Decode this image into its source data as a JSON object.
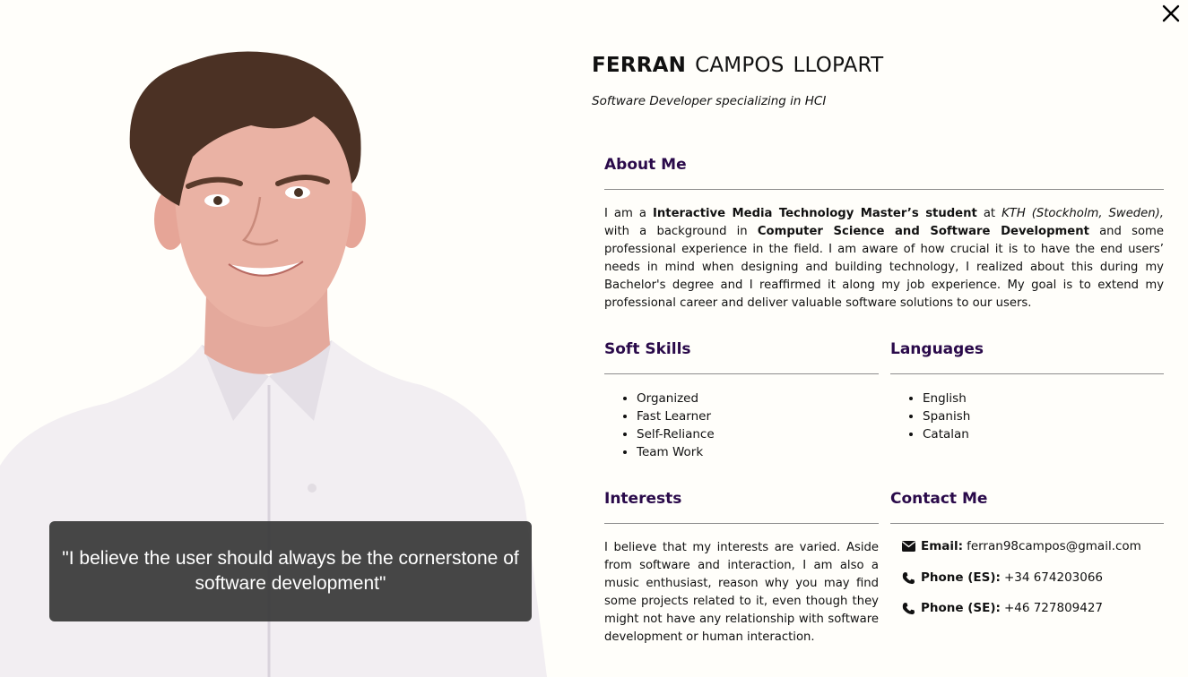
{
  "profile": {
    "first_name": "FERRAN",
    "middle_name": "CAMPOS",
    "last_name": "LLOPART",
    "tagline": "Software Developer specializing in HCI",
    "quote": "\"I believe the user should always be the cornerstone of software development\""
  },
  "about": {
    "title": "About Me",
    "p1": "I am a ",
    "b1": "Interactive Media Technology Master’s student",
    "p2": " at ",
    "i1": "KTH (Stockholm, Sweden),",
    "p3": " with a background in ",
    "b2": "Computer Science and Software Development",
    "p4": " and some professional experience in the field. I am aware of how crucial it is to have the end users’ needs in mind when designing and building technology, I realized about this during my Bachelor's degree and I reaffirmed it along my job experience. My goal is to extend my professional career and deliver valuable software solutions to our users."
  },
  "soft_skills": {
    "title": "Soft Skills",
    "items": [
      "Organized",
      "Fast Learner",
      "Self-Reliance",
      "Team Work"
    ]
  },
  "languages": {
    "title": "Languages",
    "items": [
      "English",
      "Spanish",
      "Catalan"
    ]
  },
  "interests": {
    "title": "Interests",
    "text": "I believe that my interests are varied. Aside from software and interaction, I am also a music enthusiast, reason why you may find some projects related to it, even though they might not have any relationship with software development or human interaction."
  },
  "contact": {
    "title": "Contact Me",
    "email_label": "Email:",
    "email": "ferran98campos@gmail.com",
    "phone_es_label": "Phone (ES):",
    "phone_es": "+34 674203066",
    "phone_se_label": "Phone (SE):",
    "phone_se": "+46 727809427"
  },
  "icons": {
    "close": "close-icon",
    "email": "envelope-icon",
    "phone": "phone-icon"
  },
  "colors": {
    "background": "#fffefa",
    "section_title": "#2a0a4a",
    "quote_box": "#373737"
  }
}
